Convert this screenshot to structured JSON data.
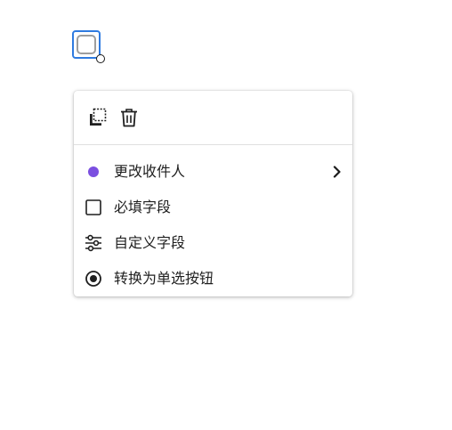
{
  "colors": {
    "selection": "#2f7be0",
    "recipient_dot": "#7b4fe0",
    "text": "#1f1f1f"
  },
  "field": {
    "type": "checkbox",
    "selected": true
  },
  "context_menu": {
    "toolbar": [
      {
        "icon": "duplicate-icon"
      },
      {
        "icon": "trash-icon"
      }
    ],
    "items": [
      {
        "label": "更改收件人",
        "icon": "recipient-color-dot-icon",
        "has_submenu": true
      },
      {
        "label": "必填字段",
        "icon": "checkbox-empty-icon"
      },
      {
        "label": "自定义字段",
        "icon": "sliders-icon"
      },
      {
        "label": "转换为单选按钮",
        "icon": "radio-button-icon"
      }
    ]
  }
}
